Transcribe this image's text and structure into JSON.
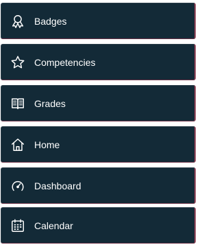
{
  "menu": {
    "items": [
      {
        "label": "Badges",
        "icon": "badge-icon"
      },
      {
        "label": "Competencies",
        "icon": "star-icon"
      },
      {
        "label": "Grades",
        "icon": "book-icon"
      },
      {
        "label": "Home",
        "icon": "home-icon"
      },
      {
        "label": "Dashboard",
        "icon": "dashboard-icon"
      },
      {
        "label": "Calendar",
        "icon": "calendar-icon"
      }
    ]
  },
  "colors": {
    "item_background": "#132a37",
    "item_border_accent": "#8a3e52",
    "text": "#ffffff"
  }
}
